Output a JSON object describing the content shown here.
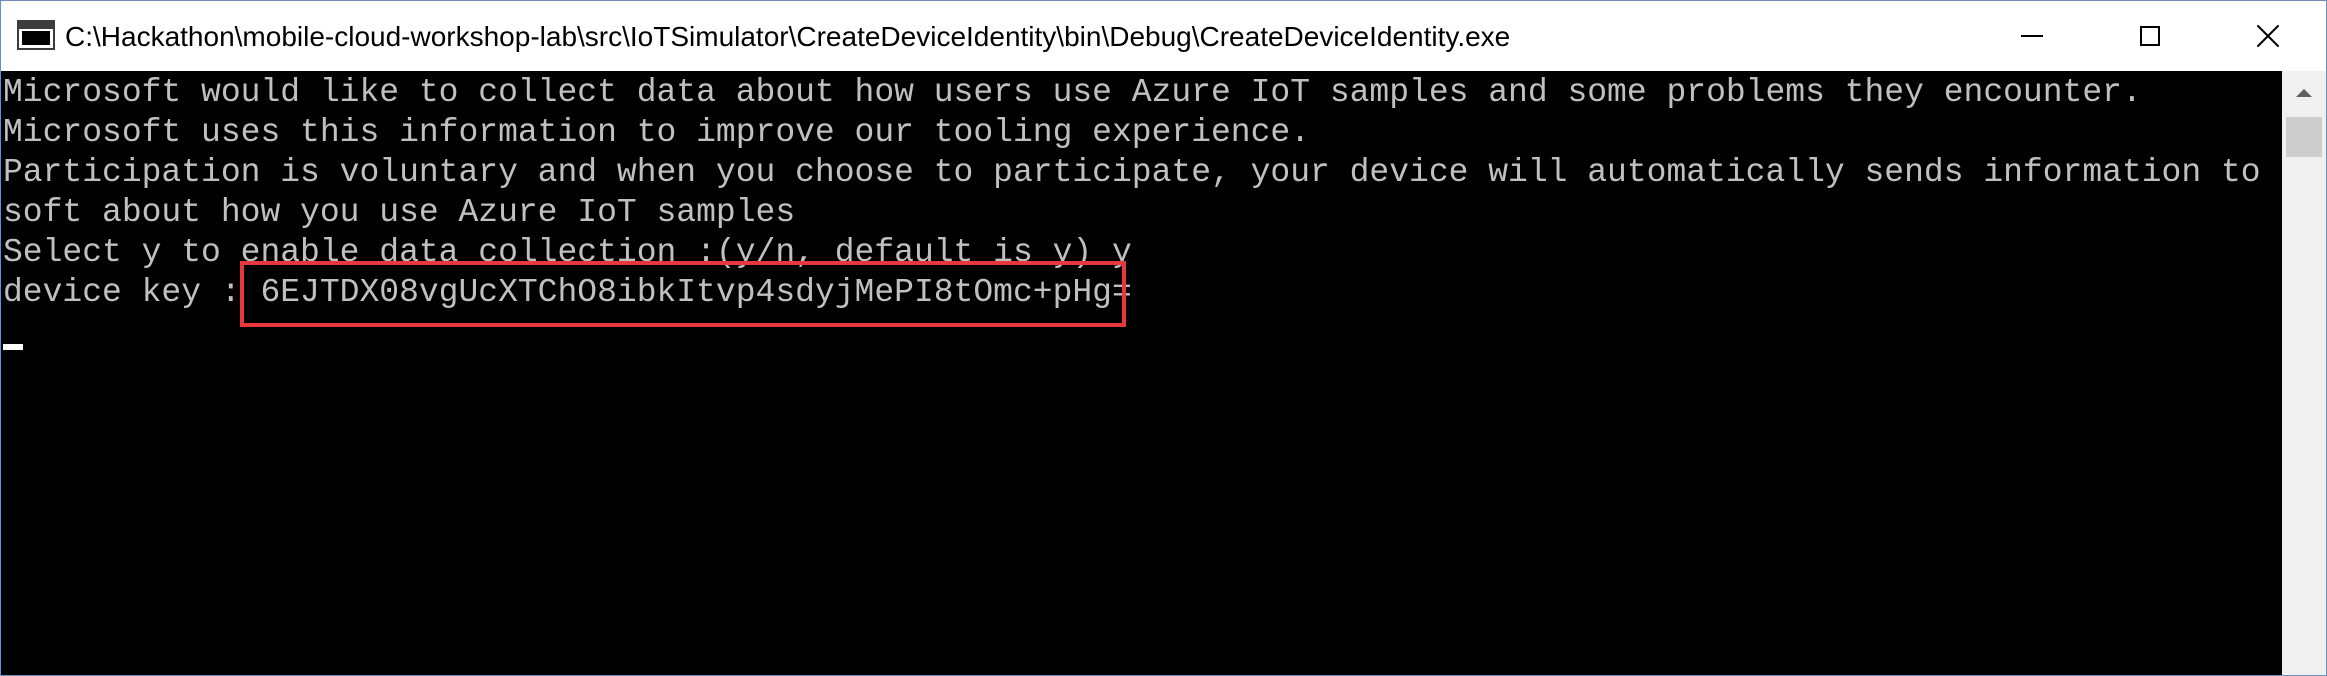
{
  "window": {
    "title": "C:\\Hackathon\\mobile-cloud-workshop-lab\\src\\IoTSimulator\\CreateDeviceIdentity\\bin\\Debug\\CreateDeviceIdentity.exe",
    "icon": "console-app-icon",
    "controls": {
      "minimize_icon": "minimize-icon",
      "maximize_icon": "maximize-icon",
      "close_icon": "close-icon"
    }
  },
  "console": {
    "lines": [
      "Microsoft would like to collect data about how users use Azure IoT samples and some problems they encounter.",
      "Microsoft uses this information to improve our tooling experience.",
      "Participation is voluntary and when you choose to participate, your device will automatically sends information to Micro",
      "soft about how you use Azure IoT samples",
      "Select y to enable data collection :(y/n, default is y) y",
      "device key : 6EJTDX08vgUcXTChO8ibkItvp4sdyjMePI8tOmc+pHg="
    ]
  },
  "colors": {
    "console_background": "#000000",
    "console_text": "#c0c0c0",
    "highlight_border": "#e8383d",
    "titlebar_background": "#ffffff"
  }
}
